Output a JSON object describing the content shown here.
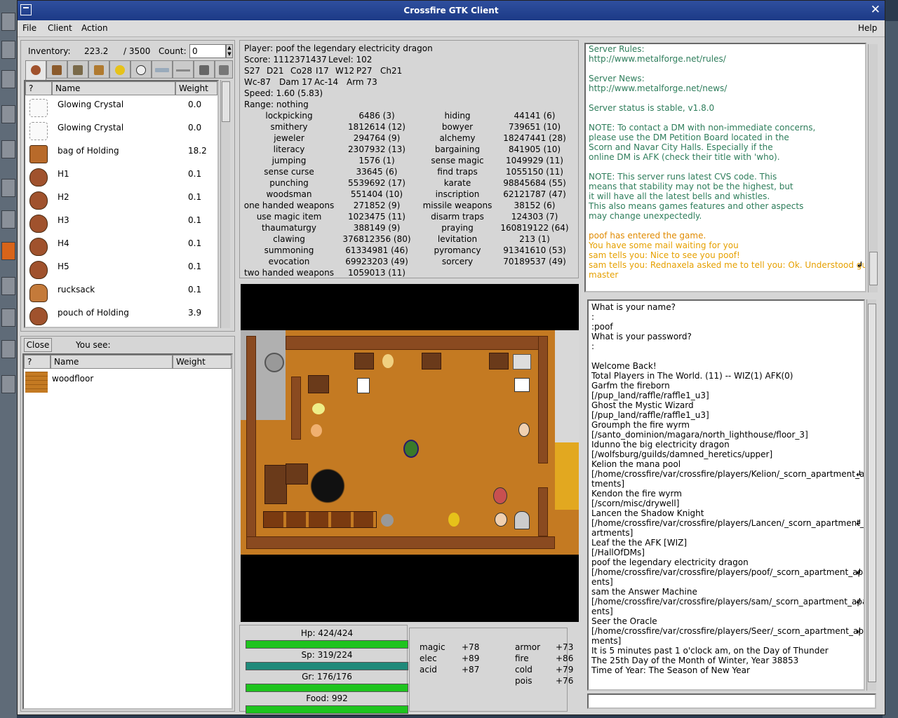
{
  "window": {
    "title": "Crossfire GTK Client"
  },
  "menu": {
    "file": "File",
    "client": "Client",
    "action": "Action",
    "help": "Help"
  },
  "inventory": {
    "label": "Inventory:",
    "weight": "223.2",
    "capacity": "/ 3500",
    "count_label": "Count:",
    "count_value": "0",
    "columns": {
      "q": "?",
      "name": "Name",
      "weight": "Weight"
    },
    "items": [
      {
        "name": "Glowing Crystal",
        "weight": "0.0",
        "icon": "crystal-icon"
      },
      {
        "name": "Glowing Crystal",
        "weight": "0.0",
        "icon": "crystal-icon"
      },
      {
        "name": "bag of Holding",
        "weight": "18.2",
        "icon": "bag-icon"
      },
      {
        "name": "H1",
        "weight": "0.1",
        "icon": "pouch-icon"
      },
      {
        "name": "H2",
        "weight": "0.1",
        "icon": "pouch-icon"
      },
      {
        "name": "H3",
        "weight": "0.1",
        "icon": "pouch-icon"
      },
      {
        "name": "H4",
        "weight": "0.1",
        "icon": "pouch-icon"
      },
      {
        "name": "H5",
        "weight": "0.1",
        "icon": "pouch-icon"
      },
      {
        "name": "rucksack",
        "weight": "0.1",
        "icon": "rucksack-icon"
      },
      {
        "name": "pouch of Holding",
        "weight": "3.9",
        "icon": "pouch-icon"
      }
    ]
  },
  "ground": {
    "close": "Close",
    "you_see": "You see:",
    "columns": {
      "q": "?",
      "name": "Name",
      "weight": "Weight"
    },
    "items": [
      {
        "name": "woodfloor",
        "weight": ""
      }
    ]
  },
  "stats": {
    "player": "Player: poof the legendary electricity dragon",
    "score": "Score: 1112371437",
    "level": "Level: 102",
    "attrs": [
      "S27",
      "D21",
      "Co28",
      "I17",
      "W12",
      "P27",
      "Ch21"
    ],
    "combat": [
      "Wc-87",
      "Dam 17",
      "Ac-14",
      "Arm 73"
    ],
    "speed": "Speed: 1.60 (5.83)",
    "range": "Range: nothing",
    "skills": [
      [
        "lockpicking",
        "6486 (3)",
        "hiding",
        "44141 (6)"
      ],
      [
        "smithery",
        "1812614 (12)",
        "bowyer",
        "739651 (10)"
      ],
      [
        "jeweler",
        "294764 (9)",
        "alchemy",
        "18247441 (28)"
      ],
      [
        "literacy",
        "2307932 (13)",
        "bargaining",
        "841905 (10)"
      ],
      [
        "jumping",
        "1576 (1)",
        "sense magic",
        "1049929 (11)"
      ],
      [
        "sense curse",
        "33645 (6)",
        "find traps",
        "1055150 (11)"
      ],
      [
        "punching",
        "5539692 (17)",
        "karate",
        "98845684 (55)"
      ],
      [
        "woodsman",
        "551404 (10)",
        "inscription",
        "62121787 (47)"
      ],
      [
        "one handed weapons",
        "271852 (9)",
        "missile weapons",
        "38152 (6)"
      ],
      [
        "use magic item",
        "1023475 (11)",
        "disarm traps",
        "124303 (7)"
      ],
      [
        "thaumaturgy",
        "388149 (9)",
        "praying",
        "160819122 (64)"
      ],
      [
        "clawing",
        "376812356 (80)",
        "levitation",
        "213 (1)"
      ],
      [
        "summoning",
        "61334981 (46)",
        "pyromancy",
        "91341610 (53)"
      ],
      [
        "evocation",
        "69923203 (49)",
        "sorcery",
        "70189537 (49)"
      ],
      [
        "two handed weapons",
        "1059013 (11)",
        "",
        ""
      ]
    ]
  },
  "vitals": [
    {
      "label": "Hp: 424/424",
      "fill": 1.0,
      "color": "#1ec41e"
    },
    {
      "label": "Sp: 319/224",
      "fill": 1.0,
      "color": "#1e8a7a"
    },
    {
      "label": "Gr: 176/176",
      "fill": 1.0,
      "color": "#1ec41e"
    },
    {
      "label": "Food: 992",
      "fill": 1.0,
      "color": "#1ec41e"
    }
  ],
  "resists": [
    [
      "magic",
      "+78",
      "armor",
      "+73"
    ],
    [
      "elec",
      "+89",
      "fire",
      "+86"
    ],
    [
      "acid",
      "+87",
      "cold",
      "+79"
    ],
    [
      "",
      "",
      "pois",
      "+76"
    ]
  ],
  "messages": [
    {
      "t": "Server Rules:",
      "c": "#2e7d5b"
    },
    {
      "t": "http://www.metalforge.net/rules/",
      "c": "#2e7d5b"
    },
    {
      "t": "",
      "c": "#2e7d5b"
    },
    {
      "t": "Server News:",
      "c": "#2e7d5b"
    },
    {
      "t": "http://www.metalforge.net/news/",
      "c": "#2e7d5b"
    },
    {
      "t": "",
      "c": "#2e7d5b"
    },
    {
      "t": "Server status is stable, v1.8.0",
      "c": "#2e7d5b"
    },
    {
      "t": "",
      "c": "#2e7d5b"
    },
    {
      "t": "NOTE: To contact a DM with non-immediate concerns,",
      "c": "#2e7d5b"
    },
    {
      "t": "please use the DM Petition Board located in the",
      "c": "#2e7d5b"
    },
    {
      "t": "Scorn and Navar City Halls.  Especially if the",
      "c": "#2e7d5b"
    },
    {
      "t": "online DM is AFK (check their title with 'who).",
      "c": "#2e7d5b"
    },
    {
      "t": "",
      "c": "#2e7d5b"
    },
    {
      "t": "NOTE: This server runs latest CVS code.  This",
      "c": "#2e7d5b"
    },
    {
      "t": "means that stability may not be the highest, but",
      "c": "#2e7d5b"
    },
    {
      "t": "it will have all the latest bells and whistles.",
      "c": "#2e7d5b"
    },
    {
      "t": "This also means games features and other aspects",
      "c": "#2e7d5b"
    },
    {
      "t": "may change unexpectedly.",
      "c": "#2e7d5b"
    },
    {
      "t": "",
      "c": "#2e7d5b"
    },
    {
      "t": "poof has entered the game.",
      "c": "#e08a00"
    },
    {
      "t": "You have some mail waiting for you",
      "c": "#e6a000"
    },
    {
      "t": "sam tells you: Nice to see you poof!",
      "c": "#e6a000"
    },
    {
      "t": "sam tells you: Rednaxela asked me to tell you: Ok. Understood guild",
      "c": "#e6a000"
    },
    {
      "t": "master",
      "c": "#e6a000"
    }
  ],
  "console": [
    "What is your name?",
    ":",
    ":poof",
    "What is your password?",
    ":",
    "",
    "Welcome Back!",
    "Total Players in The World. (11) -- WIZ(1) AFK(0)",
    "Garfm the fireborn",
    "[/pup_land/raffle/raffle1_u3]",
    "Ghost the Mystic Wizard",
    "[/pup_land/raffle/raffle1_u3]",
    "Groumph the fire wyrm",
    "[/santo_dominion/magara/north_lighthouse/floor_3]",
    "Idunno the big electricity dragon",
    "[/wolfsburg/guilds/damned_heretics/upper]",
    "Kelion the mana pool",
    "[/home/crossfire/var/crossfire/players/Kelion/_scorn_apartment_apar",
    "tments]",
    "Kendon the fire wyrm",
    "[/scorn/misc/drywell]",
    "Lancen the Shadow Knight",
    "[/home/crossfire/var/crossfire/players/Lancen/_scorn_apartment_ap",
    "artments]",
    "Leaf the the AFK [WIZ]",
    "[/HallOfDMs]",
    "poof the legendary electricity dragon",
    "[/home/crossfire/var/crossfire/players/poof/_scorn_apartment_apartm",
    "ents]",
    "sam the Answer Machine",
    "[/home/crossfire/var/crossfire/players/sam/_scorn_apartment_apartm",
    "ents]",
    "Seer the Oracle",
    "[/home/crossfire/var/crossfire/players/Seer/_scorn_apartment_apart",
    "ments]",
    "It is 5 minutes past 1 o'clock am, on the Day of Thunder",
    "The 25th Day of the Month of Winter, Year 38853",
    "Time of Year: The Season of New Year"
  ],
  "console_wrapped_lines": [
    17,
    22,
    27,
    30,
    33
  ],
  "command": {
    "value": ""
  }
}
